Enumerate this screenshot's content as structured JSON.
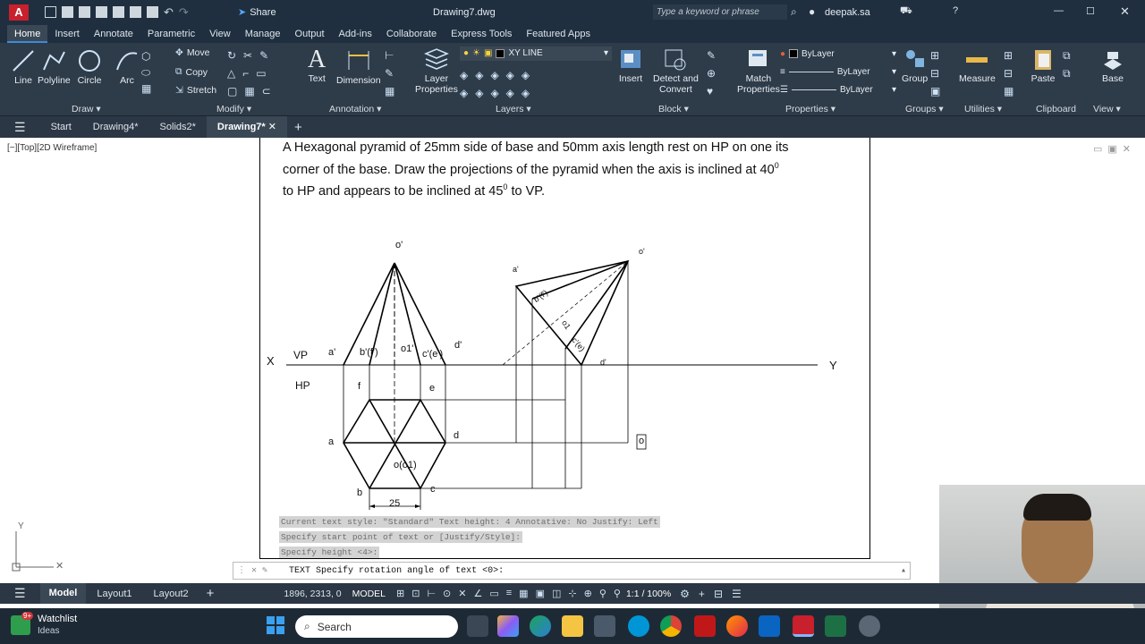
{
  "window": {
    "title": "Drawing7.dwg",
    "share_label": "Share",
    "search_placeholder": "Type a keyword or phrase",
    "user": "deepak.sa"
  },
  "menu_tabs": [
    "Home",
    "Insert",
    "Annotate",
    "Parametric",
    "View",
    "Manage",
    "Output",
    "Add-ins",
    "Collaborate",
    "Express Tools",
    "Featured Apps"
  ],
  "ribbon": {
    "draw": {
      "line": "Line",
      "polyline": "Polyline",
      "circle": "Circle",
      "arc": "Arc",
      "panel": "Draw"
    },
    "modify": {
      "move": "Move",
      "copy": "Copy",
      "stretch": "Stretch",
      "panel": "Modify"
    },
    "annotation": {
      "text": "Text",
      "dimension": "Dimension",
      "panel": "Annotation"
    },
    "layers": {
      "layer_properties": "Layer\nProperties",
      "current_layer": "XY LINE",
      "panel": "Layers"
    },
    "block": {
      "insert": "Insert",
      "detect": "Detect and\nConvert",
      "panel": "Block"
    },
    "properties": {
      "match": "Match\nProperties",
      "color": "ByLayer",
      "linetype": "ByLayer",
      "lineweight": "ByLayer",
      "panel": "Properties"
    },
    "groups": {
      "group": "Group",
      "panel": "Groups"
    },
    "utilities": {
      "measure": "Measure",
      "panel": "Utilities"
    },
    "clipboard": {
      "paste": "Paste",
      "panel": "Clipboard"
    },
    "view": {
      "base": "Base",
      "panel": "View"
    }
  },
  "doc_tabs": [
    "Start",
    "Drawing4*",
    "Solids2*",
    "Drawing7*"
  ],
  "viewport_label": "[−][Top][2D Wireframe]",
  "drawing": {
    "problem_line1": "A Hexagonal pyramid of 25mm side of base and 50mm axis length rest on HP on one its",
    "problem_line2": "corner of the base. Draw the projections of the pyramid when the axis is inclined at 40",
    "problem_line3_a": "to HP and appears  to be inclined at 45",
    "problem_line3_b": " to VP.",
    "sup": "0",
    "labels": {
      "x": "X",
      "y": "Y",
      "vp": "VP",
      "hp": "HP",
      "o_prime": "o'",
      "a_prime": "a'",
      "bf_prime": "b'(f')",
      "o1_prime": "o1'",
      "ce_prime": "c'(e')",
      "d_prime": "d'",
      "f": "f",
      "e": "e",
      "a": "a",
      "d": "d",
      "o_o1": "o(o1)",
      "b": "b",
      "c": "c",
      "dim": "25",
      "r_a": "a'",
      "r_bf": "b'(f')",
      "r_o1": "o1",
      "r_ce": "c'(e)",
      "r_d": "d'",
      "r_o": "o'",
      "cursor_text": "o"
    }
  },
  "command": {
    "history": [
      "Current text style:  \"Standard\"  Text height:  4  Annotative:  No  Justify:  Left",
      "Specify start point of text or [Justify/Style]:",
      "Specify height <4>:"
    ],
    "prompt": "TEXT Specify rotation angle of text <0>:"
  },
  "status": {
    "layout_tabs": [
      "Model",
      "Layout1",
      "Layout2"
    ],
    "coords": "1896, 2313, 0",
    "model": "MODEL",
    "scale": "1:1 / 100%"
  },
  "taskbar": {
    "widget_title": "Watchlist",
    "widget_sub": "Ideas",
    "badge": "9+",
    "search": "Search"
  }
}
